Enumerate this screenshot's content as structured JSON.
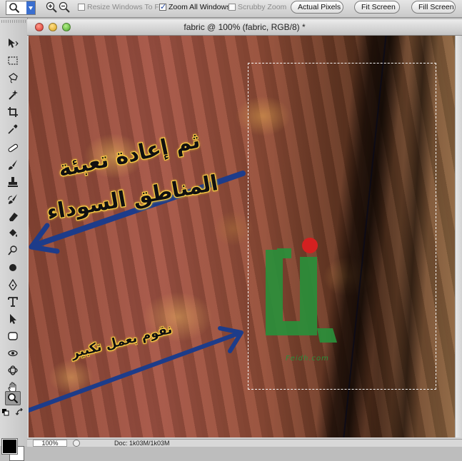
{
  "options_bar": {
    "resize_windows_label": "Resize Windows To Fit",
    "resize_windows_checked": false,
    "zoom_all_label": "Zoom All Windows",
    "zoom_all_checked": true,
    "scrubby_label": "Scrubby Zoom",
    "scrubby_checked": false,
    "actual_pixels_label": "Actual Pixels",
    "fit_screen_label": "Fit Screen",
    "fill_screen_label": "Fill Screen"
  },
  "document": {
    "title": "fabric @ 100% (fabric, RGB/8) *",
    "zoom": "100%",
    "doc_info": "Doc: 1k03M/1k03M"
  },
  "canvas": {
    "arabic_line1": "ثم إعادة تعبئة",
    "arabic_line2": "المناطق السوداء",
    "arabic_line3": "نقوم بعمل تكبير",
    "watermark": "Feidh.com"
  },
  "colors": {
    "arrow": "#1d3c8a",
    "text_glow": "#ffd34a",
    "logo_green": "#2a8f3a",
    "logo_dot": "#d42020",
    "foreground": "#000000",
    "background": "#ffffff"
  }
}
